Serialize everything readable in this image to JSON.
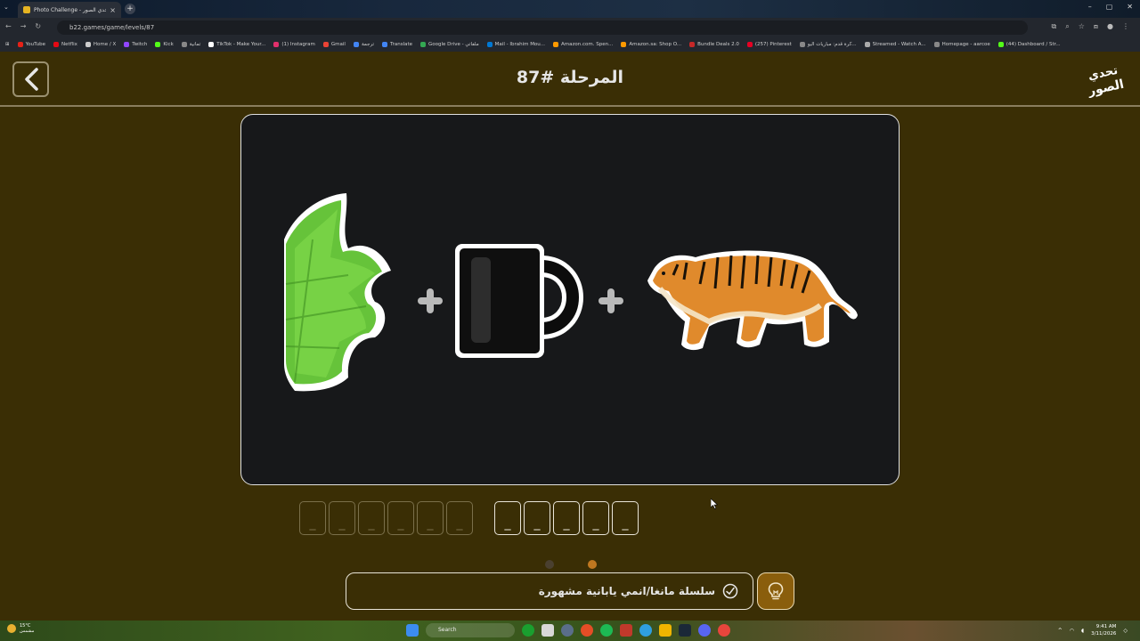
{
  "browser": {
    "tab_title": "Photo Challenge - تحدي الصور",
    "url": "b22.games/game/levels/87",
    "bookmarks": [
      {
        "label": "YouTube",
        "color": "#e62117"
      },
      {
        "label": "Netflix",
        "color": "#e50914"
      },
      {
        "label": "Home / X",
        "color": "#cccccc"
      },
      {
        "label": "Twitch",
        "color": "#9146ff"
      },
      {
        "label": "Kick",
        "color": "#53fc18"
      },
      {
        "label": "تمانية",
        "color": "#888888"
      },
      {
        "label": "TikTok - Make Your...",
        "color": "#ffffff"
      },
      {
        "label": "(1) Instagram",
        "color": "#e1306c"
      },
      {
        "label": "Gmail",
        "color": "#ea4335"
      },
      {
        "label": "ترجمة",
        "color": "#4285f4"
      },
      {
        "label": "Translate",
        "color": "#4285f4"
      },
      {
        "label": "Google Drive - ملفاتي",
        "color": "#34a853"
      },
      {
        "label": "Mail - Ibrahim Mou...",
        "color": "#0078d4"
      },
      {
        "label": "Amazon.com. Spen...",
        "color": "#ff9900"
      },
      {
        "label": "Amazon.sa: Shop O...",
        "color": "#ff9900"
      },
      {
        "label": "Bundle Deals 2.0",
        "color": "#c62828"
      },
      {
        "label": "(257) Pinterest",
        "color": "#e60023"
      },
      {
        "label": "كرة قدم: مباريات اليو...",
        "color": "#888888"
      },
      {
        "label": "Streamed - Watch A...",
        "color": "#aaaaaa"
      },
      {
        "label": "Homepage - aarcoe",
        "color": "#888888"
      },
      {
        "label": "(44) Dashboard / Str...",
        "color": "#53fc18"
      }
    ]
  },
  "header": {
    "level_title": "المرحلة #87",
    "logo_text": "تحدي الصور"
  },
  "puzzle": {
    "items": [
      "mint-leaves",
      "plus",
      "black-mug",
      "plus",
      "tiger"
    ]
  },
  "answer": {
    "word1_slots": [
      "_",
      "_",
      "_",
      "_",
      "_",
      "_"
    ],
    "word2_slots": [
      "_",
      "_",
      "_",
      "_",
      "_"
    ]
  },
  "pagination": {
    "active_index": 1,
    "colors": {
      "inactive": "#4a4030",
      "active": "#c07820"
    }
  },
  "hint": {
    "text": "سلسلة مانغا/انمي يابانية مشهورة"
  },
  "taskbar": {
    "weather_temp": "15°C",
    "weather_desc": "مشمس",
    "search_label": "Search",
    "time": "9:41 AM",
    "date": "3/11/2026"
  },
  "colors": {
    "background": "#3a2e05",
    "card": "#17181a",
    "hint_button": "#8a5e0c"
  }
}
